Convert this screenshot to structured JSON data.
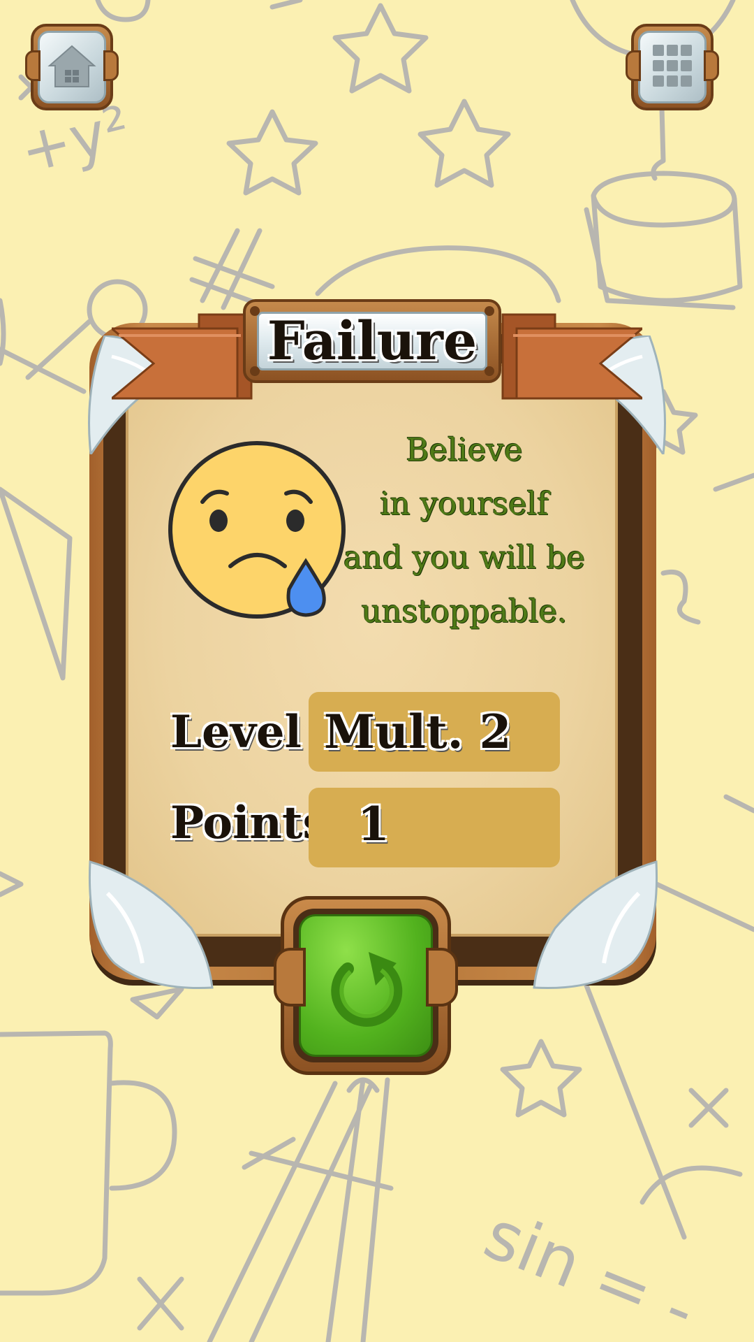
{
  "screen": "level-failed",
  "title": "Failure",
  "message": [
    "Believe",
    "in yourself",
    "and you will be",
    "unstoppable."
  ],
  "stats": {
    "level_label": "Level",
    "level_value": "Mult. 2",
    "points_label": "Points",
    "points_value": "1"
  },
  "buttons": {
    "home_icon": "house-icon",
    "menu_icon": "grid-icon",
    "retry_icon": "retry-arrow-icon"
  },
  "emoji": "sad-face-with-tear",
  "background_doodle_text": [
    "+y²",
    "sin = -"
  ],
  "colors": {
    "background": "#fbf0b2",
    "message_text": "#4f7a17",
    "stat_box": "#d7ad51",
    "retry_button": "#52b21e",
    "ribbon": "#c8703a"
  }
}
